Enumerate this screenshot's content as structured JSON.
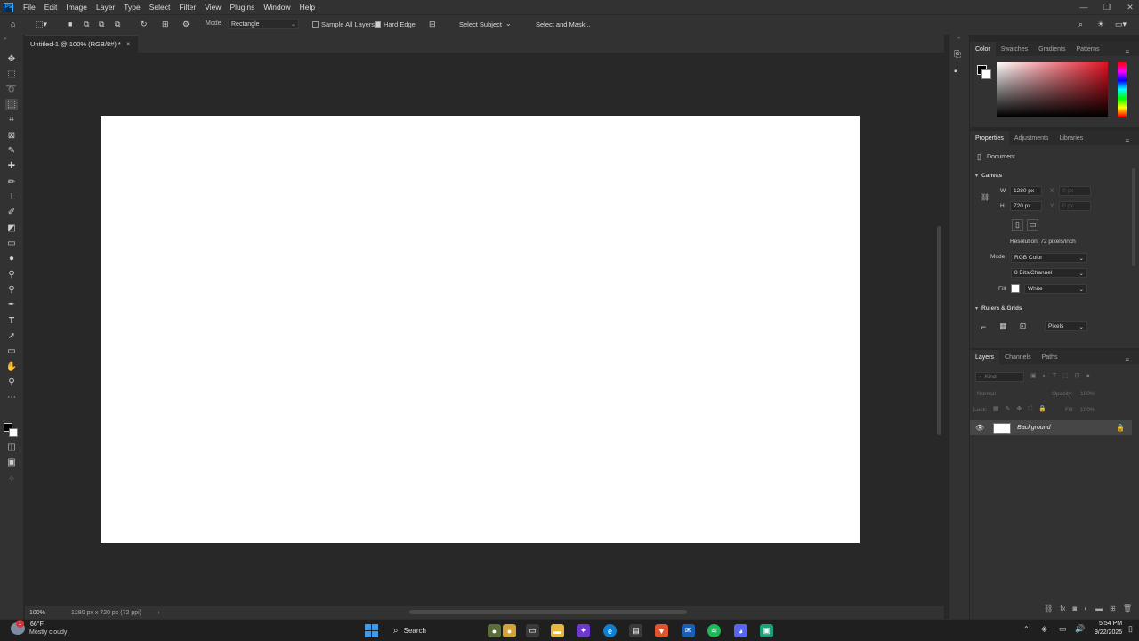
{
  "menubar": {
    "logo": "Ps",
    "items": [
      "File",
      "Edit",
      "Image",
      "Layer",
      "Type",
      "Select",
      "Filter",
      "View",
      "Plugins",
      "Window",
      "Help"
    ]
  },
  "options": {
    "mode_label": "Mode:",
    "mode_value": "Rectangle",
    "sample_all_layers": "Sample All Layers",
    "hard_edge": "Hard Edge",
    "select_subject": "Select Subject",
    "select_and_mask": "Select and Mask..."
  },
  "document": {
    "tab_title": "Untitled-1 @ 100% (RGB/8#) *",
    "tab_close": "×"
  },
  "status": {
    "zoom": "100%",
    "info": "1280 px x 720 px (72 ppi)",
    "arrow": "›"
  },
  "color_panel": {
    "tabs": [
      "Color",
      "Swatches",
      "Gradients",
      "Patterns"
    ]
  },
  "properties_panel": {
    "tabs": [
      "Properties",
      "Adjustments",
      "Libraries"
    ],
    "doc_label": "Document",
    "canvas_section": "Canvas",
    "w_label": "W",
    "w_value": "1280 px",
    "h_label": "H",
    "h_value": "720 px",
    "x_label": "X",
    "x_value": "0 px",
    "y_label": "Y",
    "y_value": "0 px",
    "resolution": "Resolution: 72 pixels/inch",
    "mode_label": "Mode",
    "mode_value": "RGB Color",
    "bits_value": "8 Bits/Channel",
    "fill_label": "Fill",
    "fill_value": "White",
    "rulers_section": "Rulers & Grids",
    "units_value": "Pixels"
  },
  "layers_panel": {
    "tabs": [
      "Layers",
      "Channels",
      "Paths"
    ],
    "kind_placeholder": "Kind",
    "blend_mode": "Normal",
    "opacity_label": "Opacity:",
    "opacity_value": "100%",
    "lock_label": "Lock:",
    "fill_label": "Fill:",
    "fill_value": "100%",
    "layer_name": "Background"
  },
  "taskbar": {
    "temp": "66°F",
    "weather": "Mostly cloudy",
    "search": "Search",
    "time": "5:54 PM",
    "date": "9/22/2025",
    "badge": "1"
  },
  "colors": {
    "accent": "#31a8ff",
    "canvas": "#ffffff",
    "workspace": "#282828",
    "panel": "#323232"
  }
}
